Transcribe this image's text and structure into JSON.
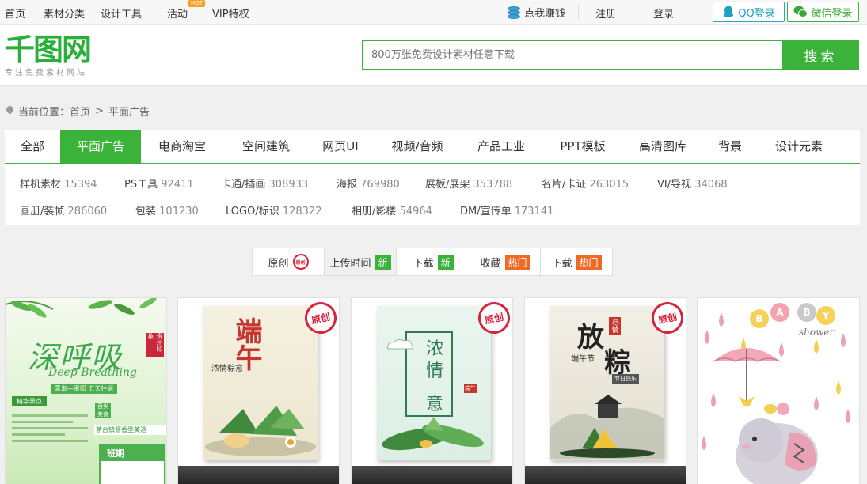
{
  "topbar": {
    "nav": [
      "首页",
      "素材分类",
      "设计工具",
      "活动",
      "VIP特权"
    ],
    "hot_tag": "HOT",
    "earn": "点我赚钱",
    "register": "注册",
    "login": "登录",
    "qq_login": "QQ登录",
    "wechat_login": "微信登录"
  },
  "header": {
    "logo": "千图网",
    "slogan": "专注免费素材网站",
    "search_placeholder": "800万张免费设计素材任意下载",
    "search_button": "搜索"
  },
  "breadcrumb": {
    "prefix": "当前位置：",
    "home": "首页",
    "separator": ">",
    "current": "平面广告"
  },
  "categories": {
    "tabs": [
      "全部",
      "平面广告",
      "电商淘宝",
      "空间建筑",
      "网页UI",
      "视频/音频",
      "产品工业",
      "PPT模板",
      "高清图库",
      "背景",
      "设计元素"
    ],
    "active": "平面广告",
    "subcats_row1": [
      {
        "name": "样机素材",
        "count": "15394"
      },
      {
        "name": "PS工具",
        "count": "92411"
      },
      {
        "name": "卡通/插画",
        "count": "308933"
      },
      {
        "name": "海报",
        "count": "769980"
      },
      {
        "name": "展板/展架",
        "count": "353788"
      },
      {
        "name": "名片/卡证",
        "count": "263015"
      },
      {
        "name": "VI/导视",
        "count": "34068"
      }
    ],
    "subcats_row2": [
      {
        "name": "画册/装帧",
        "count": "286060"
      },
      {
        "name": "包装",
        "count": "101230"
      },
      {
        "name": "LOGO/标识",
        "count": "128322"
      },
      {
        "name": "相册/影楼",
        "count": "54964"
      },
      {
        "name": "DM/宣传单",
        "count": "173141"
      }
    ]
  },
  "sort": {
    "original": "原创",
    "original_badge": "原创",
    "upload_time": "上传时间",
    "upload_tag": "新",
    "download_new": "下载",
    "download_new_tag": "新",
    "favorites": "收藏",
    "favorites_tag": "热门",
    "download_hot": "下载",
    "download_hot_tag": "热门"
  },
  "cards": {
    "stamp": "原创",
    "card1": {
      "title": "深呼吸",
      "subtitle": "Deep Breathing",
      "route": "青岛—贵阳 五天往返",
      "seal": "贵州印象",
      "section": "精华景点",
      "label": "班期",
      "badge": "舌尖美食",
      "band": "茅台镇酱香型美酒"
    },
    "card2": {
      "title": "端午",
      "subtitle": "浓情粽意"
    },
    "card3": {
      "title1": "浓",
      "title2": "情",
      "title3": "意",
      "mark": "端午"
    },
    "card4": {
      "title1": "放",
      "title2": "粽",
      "sub": "端午节",
      "seal": "尽情",
      "small": "节日快乐"
    },
    "card5": {
      "letters": [
        "B",
        "A",
        "B",
        "Y"
      ],
      "script": "shower"
    }
  },
  "colors": {
    "brand_green": "#3bb33a",
    "original_red": "#d8243a",
    "hot_orange": "#f06a24"
  }
}
